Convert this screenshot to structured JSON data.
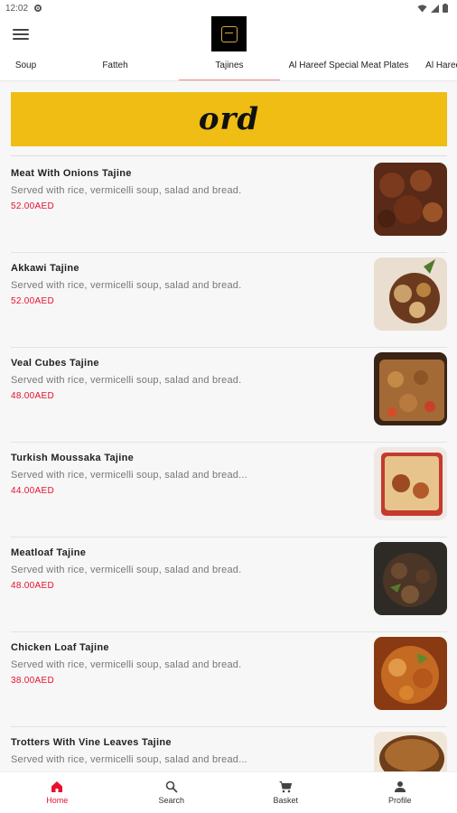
{
  "status_bar": {
    "time": "12:02",
    "icons": [
      "gear-icon",
      "wifi-icon",
      "signal-icon",
      "battery-icon"
    ]
  },
  "header": {
    "menu_icon": "hamburger-menu-icon",
    "logo_icon": "restaurant-logo"
  },
  "tabs": [
    {
      "label": "Soup",
      "active": false
    },
    {
      "label": "Fatteh",
      "active": false
    },
    {
      "label": "Tajines",
      "active": true
    },
    {
      "label": "Al Hareef Special Meat Plates",
      "active": false
    },
    {
      "label": "Al Hareef",
      "active": false
    }
  ],
  "banner": {
    "text": "ord",
    "color": "#efbd13"
  },
  "items": [
    {
      "name": "Meat With Onions Tajine",
      "description": "Served with rice, vermicelli soup, salad and bread.",
      "price": "52.00AED"
    },
    {
      "name": "Akkawi Tajine",
      "description": "Served with rice, vermicelli soup, salad and bread.",
      "price": "52.00AED"
    },
    {
      "name": "Veal Cubes Tajine",
      "description": "Served with rice, vermicelli soup, salad and bread.",
      "price": "48.00AED"
    },
    {
      "name": "Turkish Moussaka Tajine",
      "description": "Served with rice, vermicelli soup, salad and bread...",
      "price": "44.00AED"
    },
    {
      "name": "Meatloaf Tajine",
      "description": "Served with rice, vermicelli soup, salad and bread.",
      "price": "48.00AED"
    },
    {
      "name": "Chicken Loaf Tajine",
      "description": "Served with rice, vermicelli soup, salad and bread.",
      "price": "38.00AED"
    },
    {
      "name": "Trotters With Vine Leaves Tajine",
      "description": "Served with rice, vermicelli soup, salad and bread...",
      "price": ""
    }
  ],
  "bottom_nav": [
    {
      "label": "Home",
      "icon": "home-icon",
      "active": true
    },
    {
      "label": "Search",
      "icon": "search-icon",
      "active": false
    },
    {
      "label": "Basket",
      "icon": "basket-icon",
      "active": false
    },
    {
      "label": "Profile",
      "icon": "profile-icon",
      "active": false
    }
  ],
  "colors": {
    "accent": "#e8102f",
    "tab_indicator": "#f28b8b",
    "banner": "#efbd13"
  }
}
